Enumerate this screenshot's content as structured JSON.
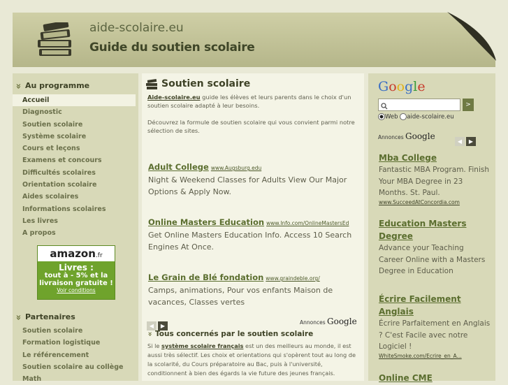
{
  "header": {
    "site_name": "aide-scolaire.eu",
    "tagline": "Guide du soutien scolaire"
  },
  "left": {
    "programme_title": "Au programme",
    "nav": [
      "Accueil",
      "Diagnostic",
      "Soutien scolaire",
      "Système scolaire",
      "Cours et leçons",
      "Examens et concours",
      "Difficultés scolaires",
      "Orientation scolaire",
      "Aides scolaires",
      "Informations scolaires",
      "Les livres",
      "A propos"
    ],
    "amazon": {
      "logo": "amazon",
      "logo_suffix": ".fr",
      "line1": "Livres :",
      "line2": "tout à - 5% et la",
      "line3": "livraison gratuite !",
      "link": "Voir conditions"
    },
    "partenaires_title": "Partenaires",
    "partners": [
      "Soutien scolaire",
      "Formation logistique",
      "Le référencement",
      "Soutien scolaire au collège",
      "Math"
    ]
  },
  "center": {
    "title": "Soutien scolaire",
    "intro_link": "Aide-scolaire.eu",
    "intro_rest": " guide les élèves et leurs parents dans le choix d'un soutien scolaire adapté à leur besoins.",
    "intro2": "Découvrez la formule de soutien scolaire qui vous convient parmi notre sélection de sites.",
    "ads": [
      {
        "title": "Adult College",
        "url": "www.Augsburg.edu",
        "desc": "Night & Weekend Classes for Adults View Our Major Options & Apply Now."
      },
      {
        "title": "Online Masters Education",
        "url": "www.Info.com/OnlineMastersEd",
        "desc": "Get Online Masters Education Info. Access 10 Search Engines At Once."
      },
      {
        "title": "Le Grain de Blé fondation",
        "url": "www.graindeble.org/",
        "desc": "Camps, animations, Pour vos enfants Maison de vacances, Classes vertes"
      }
    ],
    "annonces_label": "Annonces",
    "annonces_brand": "Google",
    "tous_title": "Tous concernés par le soutien scolaire",
    "tous_pre": "Si le ",
    "tous_link": "système scolaire français",
    "tous_rest": " est un des meilleurs au monde, il est aussi très sélectif. Les choix et orientations qui s'opèrent tout au long de la scolarité, du Cours préparatoire au Bac, puis à l'université, conditionnent à bien des égards la vie future des jeunes français."
  },
  "right": {
    "google_logo": "Google",
    "search_button": ">",
    "radio_web": "Web",
    "radio_site": "aide-scolaire.eu",
    "annonces_label": "Annonces",
    "annonces_brand": "Google",
    "ads": [
      {
        "title": "Mba College",
        "desc": "Fantastic MBA Program. Finish Your MBA Degree in 23 Months. St. Paul.",
        "url": "www.SucceedAtConcordia.com"
      },
      {
        "title": "Education Masters Degree",
        "desc": "Advance your Teaching Career Online with a Masters Degree in Education",
        "url": ""
      },
      {
        "title": "Écrire Facilement Anglais",
        "desc": "Écrire Parfaitement en Anglais ? C'est Facile avec notre Logiciel !",
        "url": "WhiteSmoke.com/Ecrire_en_A..."
      },
      {
        "title": "Online CME",
        "desc": "",
        "url": ""
      }
    ]
  },
  "colors": {
    "accent": "#5b6e2f",
    "header_bg": "#c4c49a",
    "sidebar_bg": "#d8d9b8"
  }
}
